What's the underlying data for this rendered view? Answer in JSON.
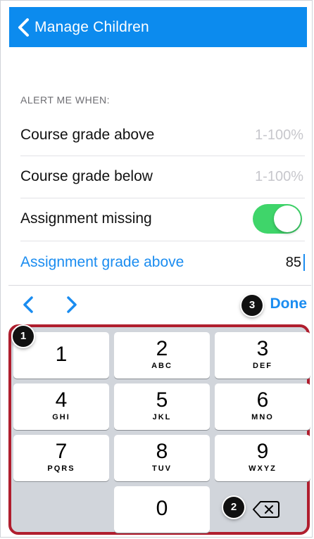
{
  "navbar": {
    "back_label": "Manage Children"
  },
  "section": {
    "header": "ALERT ME WHEN:"
  },
  "rows": [
    {
      "label": "Course grade above",
      "value": "1-100%"
    },
    {
      "label": "Course grade below",
      "value": "1-100%"
    },
    {
      "label": "Assignment missing",
      "toggle_on": true
    },
    {
      "label": "Assignment grade above",
      "value": "85"
    }
  ],
  "accessory": {
    "done_label": "Done"
  },
  "keypad": [
    {
      "num": "1",
      "letters": ""
    },
    {
      "num": "2",
      "letters": "ABC"
    },
    {
      "num": "3",
      "letters": "DEF"
    },
    {
      "num": "4",
      "letters": "GHI"
    },
    {
      "num": "5",
      "letters": "JKL"
    },
    {
      "num": "6",
      "letters": "MNO"
    },
    {
      "num": "7",
      "letters": "PQRS"
    },
    {
      "num": "8",
      "letters": "TUV"
    },
    {
      "num": "9",
      "letters": "WXYZ"
    },
    {
      "num": "0",
      "letters": ""
    }
  ],
  "callouts": [
    "1",
    "2",
    "3"
  ],
  "colors": {
    "accent": "#1a8cf0",
    "navbar": "#0c8bee",
    "toggle_on": "#3fd56a",
    "highlight_border": "#b01e2e"
  }
}
